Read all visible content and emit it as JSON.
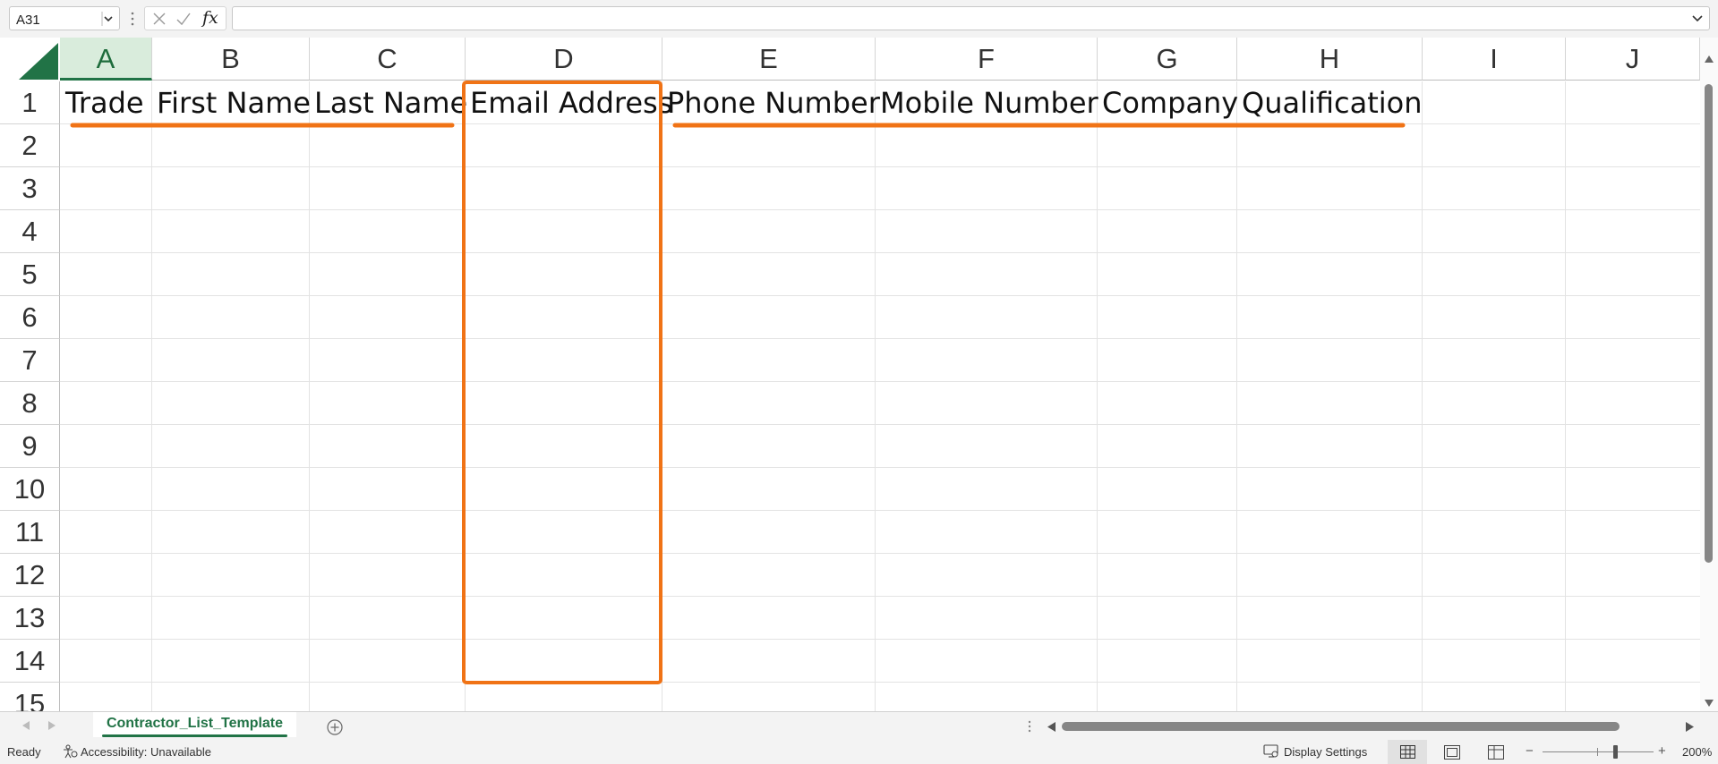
{
  "formula_bar": {
    "name_box": "A31",
    "fx_label": "fx",
    "formula_value": ""
  },
  "columns": [
    "A",
    "B",
    "C",
    "D",
    "E",
    "F",
    "G",
    "H",
    "I",
    "J"
  ],
  "selected_column": "A",
  "rows": [
    "1",
    "2",
    "3",
    "4",
    "5",
    "6",
    "7",
    "8",
    "9",
    "10",
    "11",
    "12",
    "13",
    "14",
    "15"
  ],
  "row1_cells": {
    "A": "Trade",
    "B": "First Name",
    "C": "Last Name",
    "D": "Email Address",
    "E": "Phone Number",
    "F": "Mobile Number",
    "G": "Company",
    "H": "Qualification"
  },
  "annotation_color": "#f07316",
  "accent_color": "#217346",
  "sheet_tabs": [
    {
      "label": "Contractor_List_Template",
      "active": true
    }
  ],
  "status_bar": {
    "ready": "Ready",
    "accessibility": "Accessibility: Unavailable",
    "display_settings": "Display Settings",
    "zoom": "200%"
  },
  "icons": {
    "name_box_dropdown": "chevron-down-icon",
    "cancel": "close-icon",
    "enter": "checkmark-icon",
    "formula": "fx-icon",
    "add_sheet": "plus-circle-icon",
    "accessibility": "accessibility-icon",
    "display_settings": "display-settings-icon",
    "view_normal": "grid-view-icon",
    "view_layout": "page-layout-icon",
    "view_break": "page-break-icon"
  }
}
